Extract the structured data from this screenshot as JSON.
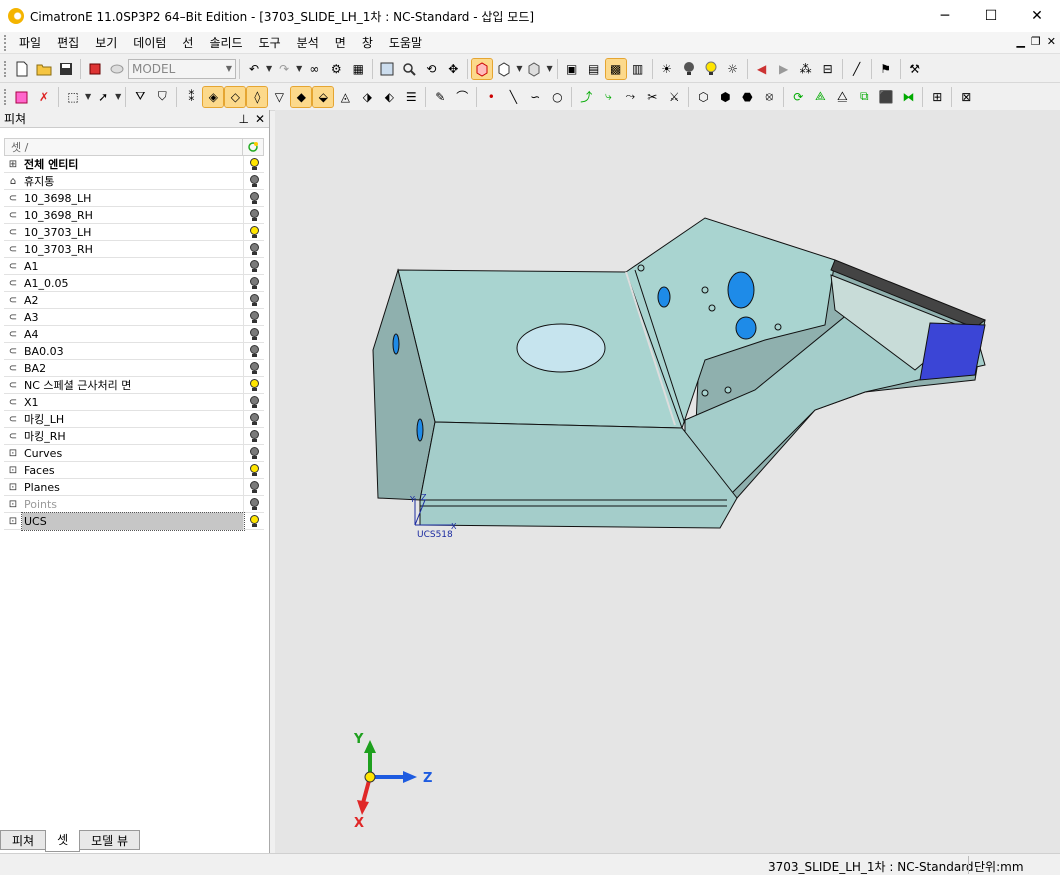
{
  "window": {
    "title": "CimatronE 11.0SP3P2 64–Bit Edition - [3703_SLIDE_LH_1차 : NC-Standard - 삽입 모드]",
    "minimize": "─",
    "maximize": "☐",
    "close": "✕"
  },
  "menu": {
    "items": [
      "파일",
      "편집",
      "보기",
      "데이텀",
      "선",
      "솔리드",
      "도구",
      "분석",
      "면",
      "창",
      "도움말"
    ],
    "mdi_minimize": "▁",
    "mdi_restore": "❐",
    "mdi_close": "✕"
  },
  "toolbar": {
    "model_select": "MODEL"
  },
  "panel": {
    "title": "피쳐",
    "pin": "⊥",
    "close": "✕",
    "column_header": "셋 /",
    "items": [
      {
        "label": "전체 엔티티",
        "bulb": "on",
        "bold": true
      },
      {
        "label": "휴지통",
        "bulb": "off"
      },
      {
        "label": "10_3698_LH",
        "bulb": "off"
      },
      {
        "label": "10_3698_RH",
        "bulb": "off"
      },
      {
        "label": "10_3703_LH",
        "bulb": "on"
      },
      {
        "label": "10_3703_RH",
        "bulb": "off"
      },
      {
        "label": "A1",
        "bulb": "off"
      },
      {
        "label": "A1_0.05",
        "bulb": "off"
      },
      {
        "label": "A2",
        "bulb": "off"
      },
      {
        "label": "A3",
        "bulb": "off"
      },
      {
        "label": "A4",
        "bulb": "off"
      },
      {
        "label": "BA0.03",
        "bulb": "off"
      },
      {
        "label": "BA2",
        "bulb": "off"
      },
      {
        "label": "NC 스페셜 근사처리 면",
        "bulb": "on"
      },
      {
        "label": "X1",
        "bulb": "off"
      },
      {
        "label": "마킹_LH",
        "bulb": "off"
      },
      {
        "label": "마킹_RH",
        "bulb": "off"
      },
      {
        "label": "Curves",
        "bulb": "off"
      },
      {
        "label": "Faces",
        "bulb": "on"
      },
      {
        "label": "Planes",
        "bulb": "off"
      },
      {
        "label": "Points",
        "bulb": "off",
        "gray": true
      },
      {
        "label": "UCS",
        "bulb": "on",
        "selected": true
      }
    ],
    "tabs": [
      "피쳐",
      "셋",
      "모델 뷰"
    ]
  },
  "viewport": {
    "ucs_label": "UCS518",
    "ucs_axis_x": "X",
    "ucs_axis_y": "Y",
    "ucs_axis_z": "Z",
    "triad_x": "X",
    "triad_y": "Y",
    "triad_z": "Z",
    "colors": {
      "part_face": "#a9d4d0",
      "part_side": "#8fb0ae",
      "hole": "#1e8be8",
      "end_face": "#3b45d6",
      "axis_y": "#1ea01e",
      "axis_z": "#1d5be0",
      "axis_x": "#e02828"
    }
  },
  "status": {
    "document": "3703_SLIDE_LH_1차 : NC-Standard",
    "units": "단위:mm"
  },
  "icons": [
    "new-file-icon",
    "open-folder-icon",
    "save-icon",
    "undo-icon",
    "redo-icon",
    "zoom-icon",
    "rotate-icon",
    "pan-icon",
    "view-cube-icon",
    "lightbulb-icon",
    "filter-icon",
    "line-icon",
    "arc-icon",
    "circle-icon",
    "sketch-icon",
    "solid-icon"
  ]
}
